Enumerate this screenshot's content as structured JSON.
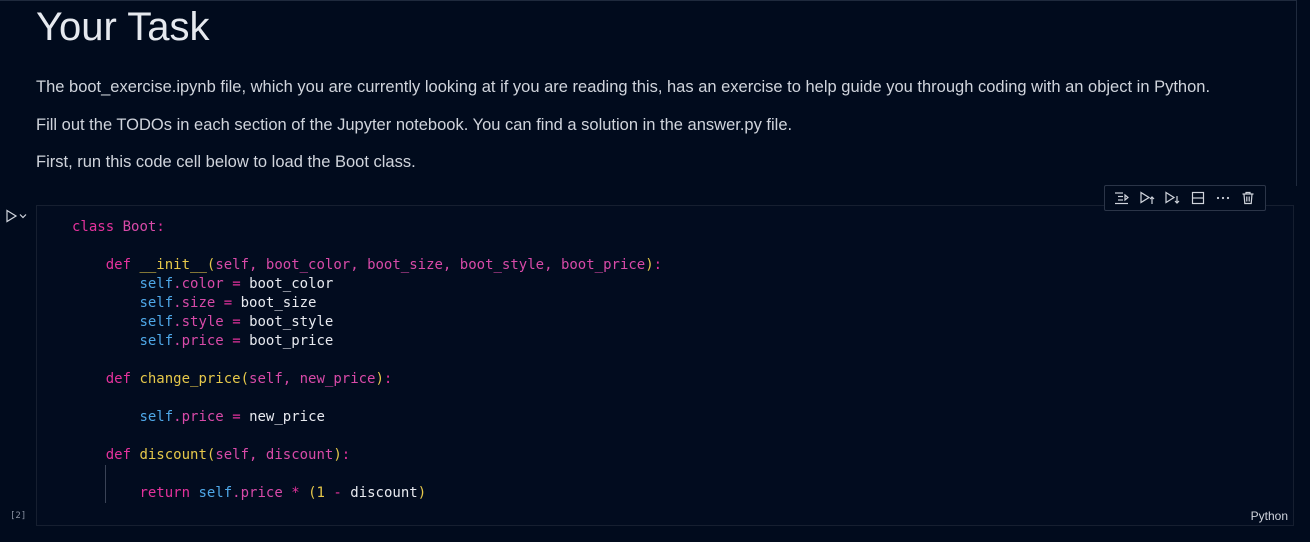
{
  "markdown": {
    "title": "Your Task",
    "para1": "The boot_exercise.ipynb file, which you are currently looking at if you are reading this, has an exercise to help guide you through coding with an object in Python.",
    "para2": "Fill out the TODOs in each section of the Jupyter notebook. You can find a solution in the answer.py file.",
    "para3": "First, run this code cell below to load the Boot class."
  },
  "toolbar": {
    "icons": [
      "run-by-line-icon",
      "execute-above-icon",
      "execute-below-icon",
      "split-cell-icon",
      "more-actions-icon",
      "delete-cell-icon"
    ]
  },
  "code_cell": {
    "execution_count": "[2]",
    "language": "Python",
    "lines": [
      "class Boot:",
      "",
      "    def __init__(self, boot_color, boot_size, boot_style, boot_price):",
      "        self.color = boot_color",
      "        self.size = boot_size",
      "        self.style = boot_style",
      "        self.price = boot_price",
      "",
      "    def change_price(self, new_price):",
      "",
      "        self.price = new_price",
      "",
      "    def discount(self, discount):",
      "",
      "        return self.price * (1 - discount)"
    ]
  },
  "colors": {
    "background": "#010b1d",
    "keyword": "#e4329c",
    "function": "#e6c84a",
    "self": "#4fa8e8",
    "param": "#d84aa8"
  }
}
